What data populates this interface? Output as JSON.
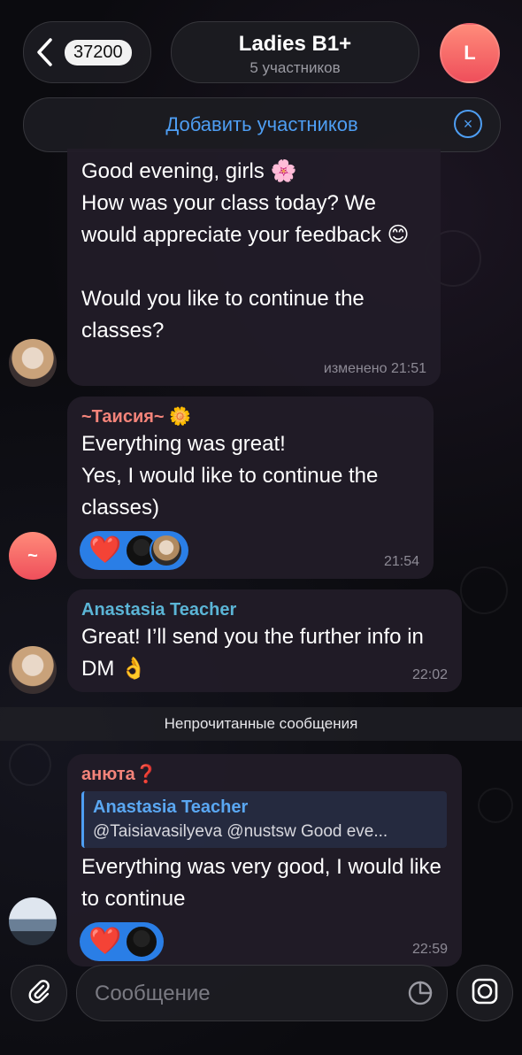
{
  "header": {
    "back_count": "37200",
    "title": "Ladies B1+",
    "subtitle": "5 участников",
    "avatar_letter": "L"
  },
  "add_members": {
    "label": "Добавить участников"
  },
  "messages": [
    {
      "text": "Good evening, girls 🌸\nHow was your class today? We would appreciate your feedback 😊\n\nWould you like to continue the classes?",
      "time": "изменено 21:51"
    },
    {
      "sender": "~Таисия~ 🌼",
      "text": "Everything was great!\nYes, I would like to continue the classes)",
      "reaction": "❤️",
      "time": "21:54",
      "avatar_char": "~"
    },
    {
      "sender": "Anastasia Teacher",
      "text": "Great! I’ll send you the further info in DM 👌",
      "time": "22:02"
    },
    {
      "sender": "анюта❓",
      "reply_name": "Anastasia Teacher",
      "reply_text": "@Taisiavasilyeva @nustsw Good eve...",
      "text": "Everything was very good, I would like to continue",
      "reaction": "❤️",
      "time": "22:59"
    }
  ],
  "divider": "Непрочитанные сообщения",
  "composer": {
    "placeholder": "Сообщение"
  },
  "colors": {
    "accent": "#4e9ef3",
    "reaction_bg": "#2a7ee6",
    "sender_pink": "#f4847a",
    "sender_teal": "#5bb5d6"
  }
}
